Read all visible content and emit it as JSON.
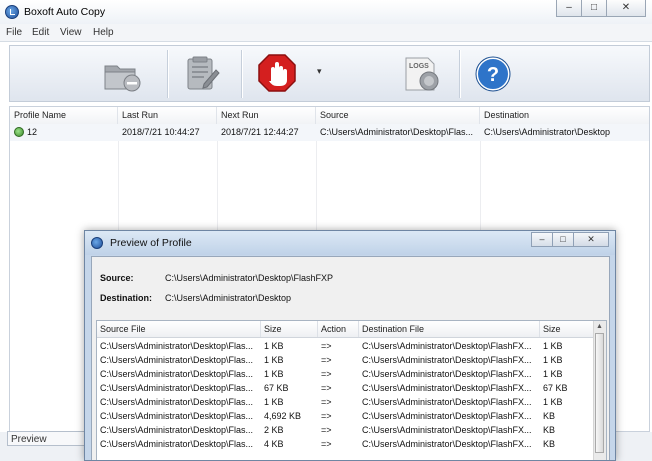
{
  "app": {
    "title": "Boxoft Auto Copy",
    "window_buttons": [
      "–",
      "□",
      "✕"
    ]
  },
  "menu": [
    "File",
    "Edit",
    "View",
    "Help"
  ],
  "toolbar": {
    "icons": [
      "delete-folder-icon",
      "edit-profile-icon",
      "stop-hand-icon",
      "logs-icon",
      "help-icon"
    ],
    "dropdown_glyph": "▾",
    "logs_label": "LOGS",
    "help_glyph": "?"
  },
  "profiles_table": {
    "columns": [
      "Profile Name",
      "Last Run",
      "Next Run",
      "Source",
      "Destination"
    ],
    "rows": [
      [
        "12",
        "2018/7/21 10:44:27",
        "2018/7/21 12:44:27",
        "C:\\Users\\Administrator\\Desktop\\Flas...",
        "C:\\Users\\Administrator\\Desktop"
      ]
    ]
  },
  "statusbar": {
    "preview_label": "Preview"
  },
  "preview_dialog": {
    "title": "Preview of Profile",
    "window_buttons": [
      "–",
      "□",
      "✕"
    ],
    "source_label": "Source:",
    "source_value": "C:\\Users\\Administrator\\Desktop\\FlashFXP",
    "destination_label": "Destination:",
    "destination_value": "C:\\Users\\Administrator\\Desktop",
    "columns": [
      "Source File",
      "Size",
      "Action",
      "Destination File",
      "Size"
    ],
    "rows": [
      [
        "C:\\Users\\Administrator\\Desktop\\Flas...",
        "1 KB",
        "=>",
        "C:\\Users\\Administrator\\Desktop\\FlashFX...",
        "1 KB"
      ],
      [
        "C:\\Users\\Administrator\\Desktop\\Flas...",
        "1 KB",
        "=>",
        "C:\\Users\\Administrator\\Desktop\\FlashFX...",
        "1 KB"
      ],
      [
        "C:\\Users\\Administrator\\Desktop\\Flas...",
        "1 KB",
        "=>",
        "C:\\Users\\Administrator\\Desktop\\FlashFX...",
        "1 KB"
      ],
      [
        "C:\\Users\\Administrator\\Desktop\\Flas...",
        "67 KB",
        "=>",
        "C:\\Users\\Administrator\\Desktop\\FlashFX...",
        "67 KB"
      ],
      [
        "C:\\Users\\Administrator\\Desktop\\Flas...",
        "1 KB",
        "=>",
        "C:\\Users\\Administrator\\Desktop\\FlashFX...",
        "1 KB"
      ],
      [
        "C:\\Users\\Administrator\\Desktop\\Flas...",
        "4,692 KB",
        "=>",
        "C:\\Users\\Administrator\\Desktop\\FlashFX...",
        "KB"
      ],
      [
        "C:\\Users\\Administrator\\Desktop\\Flas...",
        "2 KB",
        "=>",
        "C:\\Users\\Administrator\\Desktop\\FlashFX...",
        "KB"
      ],
      [
        "C:\\Users\\Administrator\\Desktop\\Flas...",
        "4 KB",
        "=>",
        "C:\\Users\\Administrator\\Desktop\\FlashFX...",
        "KB"
      ]
    ]
  }
}
